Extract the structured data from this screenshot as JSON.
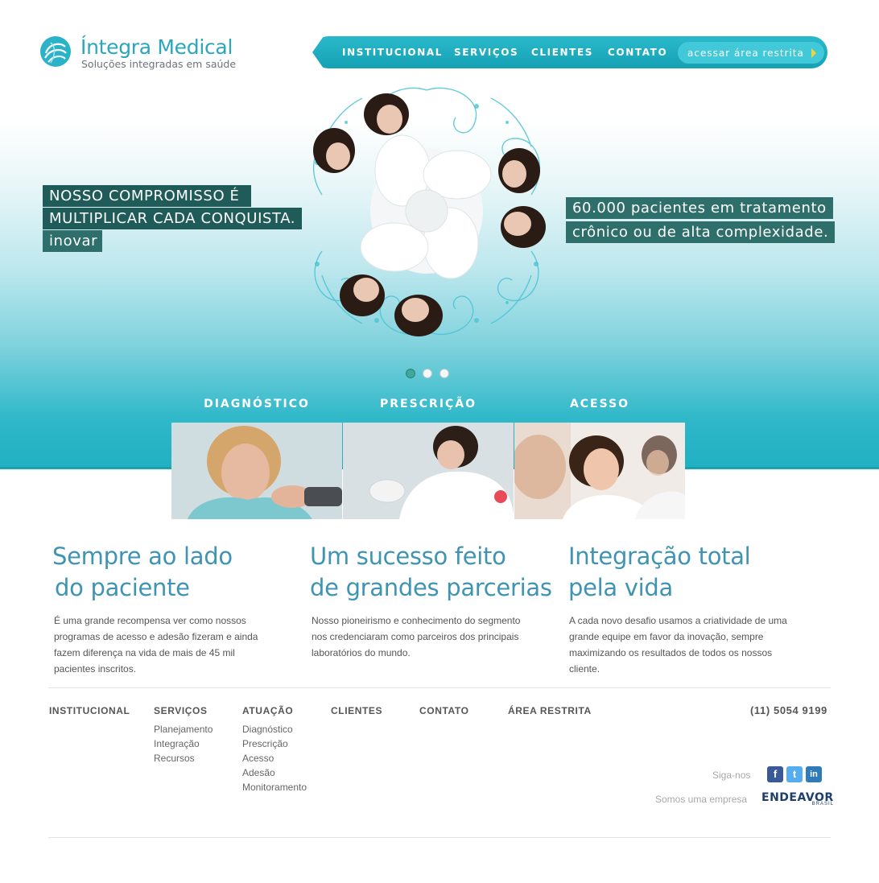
{
  "brand": {
    "name": "Íntegra Medical",
    "tagline": "Soluções integradas em saúde"
  },
  "topnav": {
    "items": [
      {
        "label": "INSTITUCIONAL"
      },
      {
        "label": "SERVIÇOS"
      },
      {
        "label": "CLIENTES"
      },
      {
        "label": "CONTATO"
      }
    ],
    "restricted_label": "acessar área restrita"
  },
  "hero": {
    "left_lines": [
      "NOSSO COMPROMISSO É",
      "MULTIPLICAR CADA CONQUISTA.",
      "inovar"
    ],
    "right_lines": [
      "60.000 pacientes em tratamento",
      "crônico ou de alta complexidade."
    ],
    "slides_count": 3,
    "active_slide": 1
  },
  "features": [
    {
      "label": "DIAGNÓSTICO"
    },
    {
      "label": "PRESCRIÇÃO"
    },
    {
      "label": "ACESSO"
    }
  ],
  "columns": [
    {
      "title_lines": [
        "Sempre ao lado",
        "do paciente"
      ],
      "text_lines": [
        "É uma grande recompensa ver como nossos",
        "programas de acesso e adesão fizeram e ainda",
        "fazem diferença na vida de mais de 45 mil",
        "pacientes inscritos."
      ]
    },
    {
      "title_lines": [
        "Um sucesso feito",
        "de grandes parcerias"
      ],
      "text_lines": [
        "Nosso pioneirismo e conhecimento do segmento",
        "nos credenciaram como parceiros dos principais",
        "laboratórios do mundo."
      ]
    },
    {
      "title_lines": [
        "Integração total",
        "pela vida"
      ],
      "text_lines": [
        "A cada novo desafio usamos a criatividade de uma",
        "grande equipe em favor da inovação, sempre",
        "maximizando os resultados de todos os nossos",
        "cliente."
      ]
    }
  ],
  "footer": {
    "sections": [
      {
        "heading": "INSTITUCIONAL",
        "links": []
      },
      {
        "heading": "SERVIÇOS",
        "links": [
          "Planejamento",
          "Integração",
          "Recursos"
        ]
      },
      {
        "heading": "ATUAÇÃO",
        "links": [
          "Diagnóstico",
          "Prescrição",
          "Acesso",
          "Adesão",
          "Monitoramento"
        ]
      },
      {
        "heading": "CLIENTES",
        "links": []
      },
      {
        "heading": "CONTATO",
        "links": []
      },
      {
        "heading": "ÁREA RESTRITA",
        "links": []
      }
    ],
    "phone": "(11) 5054 9199",
    "follow_label": "Siga-nos",
    "social": [
      {
        "icon": "facebook-icon",
        "glyph": "f"
      },
      {
        "icon": "twitter-icon",
        "glyph": "t"
      },
      {
        "icon": "linkedin-icon",
        "glyph": "in"
      }
    ],
    "company_label": "Somos uma empresa",
    "partner_logo": {
      "name": "ENDEAVOR",
      "sub": "BRASIL"
    }
  },
  "colors": {
    "accent": "#1fb1c4",
    "title_blue": "#3f94b3",
    "tag_dark": "#1f5b58"
  }
}
